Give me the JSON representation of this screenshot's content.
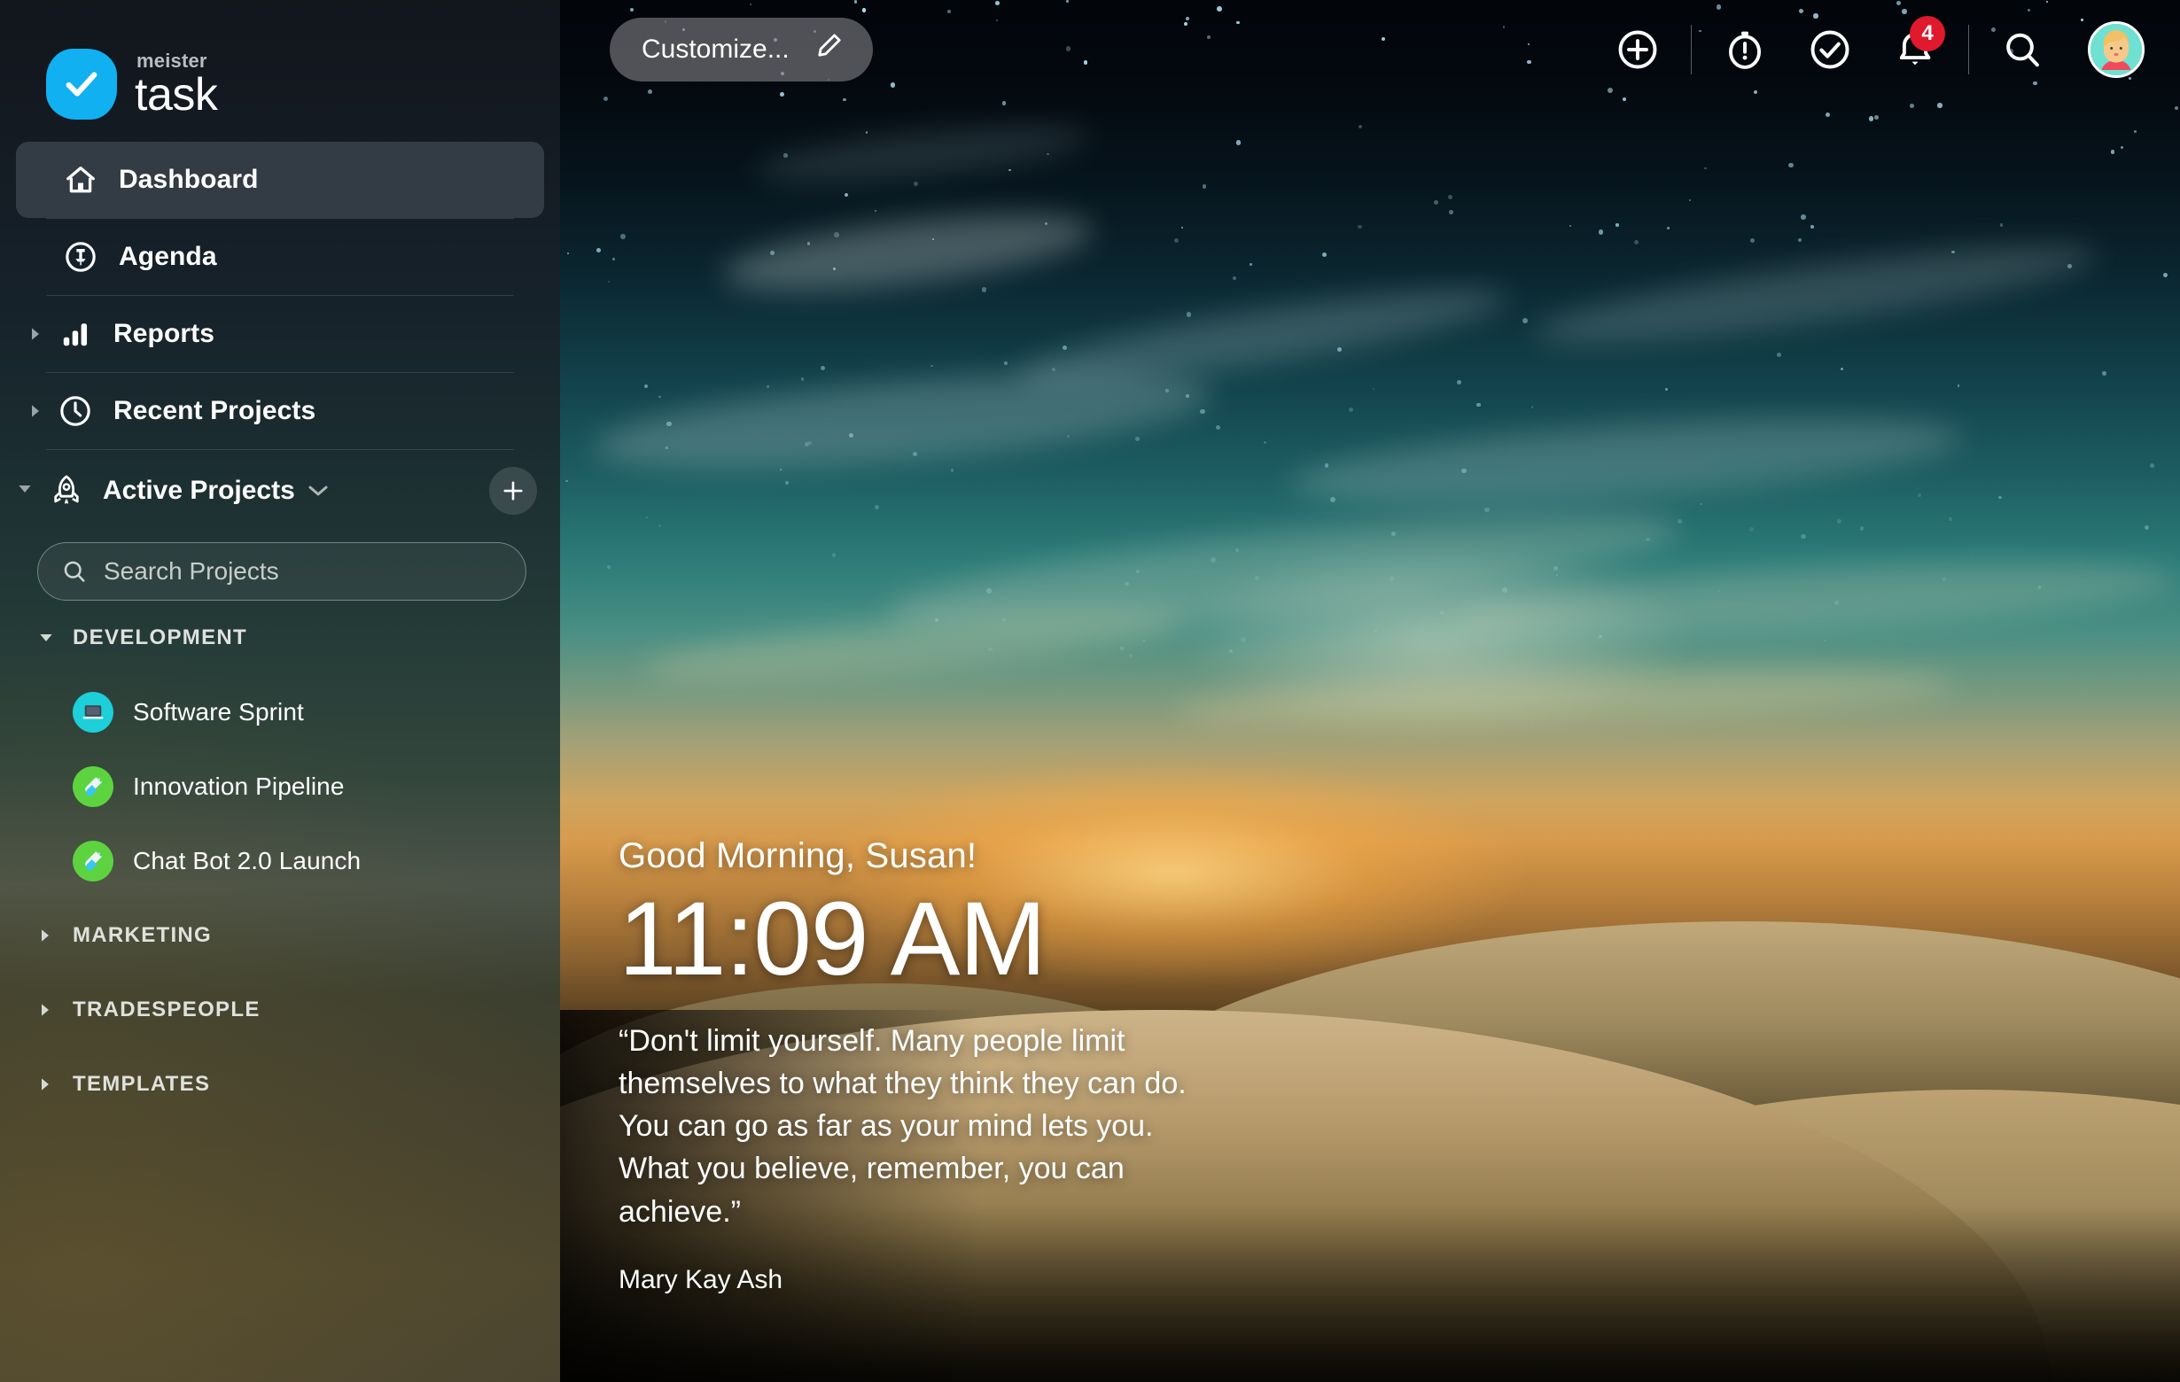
{
  "brand": {
    "meister": "meister",
    "task": "task",
    "accent_color": "#11b0f0",
    "logo_icon": "checkmark-icon"
  },
  "sidebar": {
    "nav": [
      {
        "label": "Dashboard",
        "icon": "home-icon",
        "active": true,
        "caret": false
      },
      {
        "label": "Agenda",
        "icon": "pin-circle-icon",
        "active": false,
        "caret": false
      },
      {
        "label": "Reports",
        "icon": "bar-chart-icon",
        "active": false,
        "caret": true
      },
      {
        "label": "Recent Projects",
        "icon": "clock-icon",
        "active": false,
        "caret": true
      }
    ],
    "active_projects": {
      "label": "Active Projects",
      "icon": "rocket-icon",
      "dropdown_icon": "chevron-down-icon",
      "add_icon": "plus-icon",
      "expanded": true
    },
    "search": {
      "placeholder": "Search Projects",
      "value": "",
      "icon": "search-icon"
    },
    "groups": [
      {
        "name": "DEVELOPMENT",
        "expanded": true,
        "projects": [
          {
            "name": "Software Sprint",
            "icon": "laptop-icon",
            "color": "#1ccfd8"
          },
          {
            "name": "Innovation Pipeline",
            "icon": "test-tube-icon",
            "color": "#5dd43f"
          },
          {
            "name": "Chat Bot 2.0 Launch",
            "icon": "test-tube-icon",
            "color": "#5dd43f"
          }
        ]
      },
      {
        "name": "MARKETING",
        "expanded": false,
        "projects": []
      },
      {
        "name": "TRADESPEOPLE",
        "expanded": false,
        "projects": []
      },
      {
        "name": "TEMPLATES",
        "expanded": false,
        "projects": []
      }
    ]
  },
  "topbar": {
    "customize": {
      "label": "Customize...",
      "icon": "pencil-icon"
    },
    "actions": [
      {
        "name": "add",
        "icon": "plus-circle-icon"
      },
      {
        "name": "timer",
        "icon": "stopwatch-icon"
      },
      {
        "name": "tasks",
        "icon": "check-circle-icon"
      },
      {
        "name": "notifications",
        "icon": "bell-icon",
        "badge": "4",
        "badge_color": "#e0192c"
      },
      {
        "name": "search",
        "icon": "search-icon"
      }
    ],
    "avatar": {
      "icon": "avatar",
      "bg_color": "#6fe0d2"
    }
  },
  "dashboard": {
    "greeting": "Good Morning, Susan!",
    "time": "11:09 AM",
    "quote": "“Don't limit yourself. Many people limit\nthemselves to what they think they can do.\nYou can go as far as your mind lets you.\nWhat you believe, remember, you can\nachieve.”",
    "quote_author": "Mary Kay Ash"
  }
}
